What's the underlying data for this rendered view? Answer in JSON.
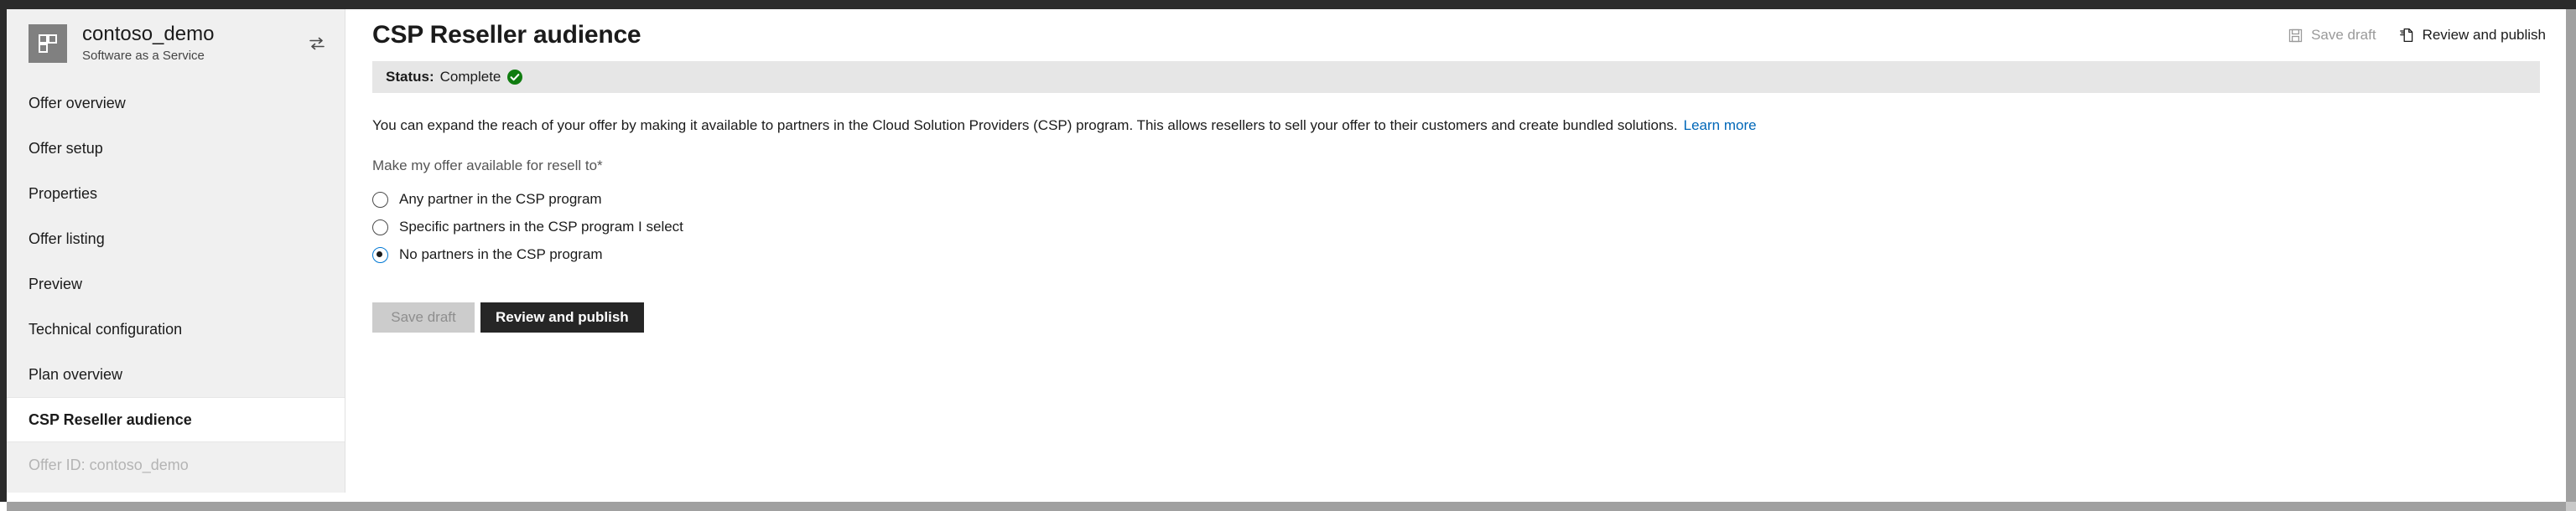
{
  "offer": {
    "name": "contoso_demo",
    "type": "Software as a Service",
    "logo_icon": "blocks-logo-icon",
    "switch_icon": "switch-offer-icon"
  },
  "sidebar": {
    "items": [
      {
        "label": "Offer overview",
        "active": false
      },
      {
        "label": "Offer setup",
        "active": false
      },
      {
        "label": "Properties",
        "active": false
      },
      {
        "label": "Offer listing",
        "active": false
      },
      {
        "label": "Preview",
        "active": false
      },
      {
        "label": "Technical configuration",
        "active": false
      },
      {
        "label": "Plan overview",
        "active": false
      },
      {
        "label": "CSP Reseller audience",
        "active": true
      }
    ],
    "offer_id": "Offer ID: contoso_demo"
  },
  "header": {
    "title": "CSP Reseller audience",
    "save_draft_label": "Save draft",
    "save_draft_icon": "save-floppy-icon",
    "review_publish_label": "Review and publish",
    "review_publish_icon": "publish-document-icon"
  },
  "status": {
    "label": "Status:",
    "value": "Complete",
    "icon": "green-check-icon",
    "color": "#107c10"
  },
  "content": {
    "description": "You can expand the reach of your offer by making it available to partners in the Cloud Solution Providers (CSP) program. This allows resellers to sell your offer to their customers and create bundled solutions.",
    "learn_more_label": "Learn more",
    "field_label": "Make my offer available for resell to",
    "required_marker": "*",
    "options": [
      {
        "label": "Any partner in the CSP program",
        "selected": false
      },
      {
        "label": "Specific partners in the CSP program I select",
        "selected": false
      },
      {
        "label": "No partners in the CSP program",
        "selected": true
      }
    ]
  },
  "footer": {
    "save_draft_label": "Save draft",
    "review_publish_label": "Review and publish"
  },
  "colors": {
    "accent_link": "#0067b8",
    "primary_button": "#262626",
    "status_green": "#107c10",
    "radio_selected_ring": "#0078d4"
  }
}
